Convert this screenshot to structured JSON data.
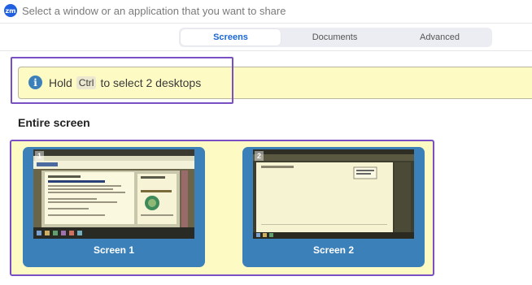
{
  "window": {
    "app_badge": "zm",
    "title": "Select a window or an application that you want to share"
  },
  "tabs": [
    {
      "label": "Screens",
      "active": true
    },
    {
      "label": "Documents",
      "active": false
    },
    {
      "label": "Advanced",
      "active": false
    }
  ],
  "banner": {
    "icon": "info-icon",
    "text_before": "Hold",
    "key": "Ctrl",
    "text_after": "to select 2 desktops"
  },
  "section": {
    "title": "Entire screen"
  },
  "screens": [
    {
      "number": "1",
      "label": "Screen 1"
    },
    {
      "number": "2",
      "label": "Screen 2"
    }
  ],
  "colors": {
    "accent": "#1a66d6",
    "card": "#3b80b8",
    "highlight_bg": "#fdfac4",
    "annotation": "#7b4fc4"
  }
}
